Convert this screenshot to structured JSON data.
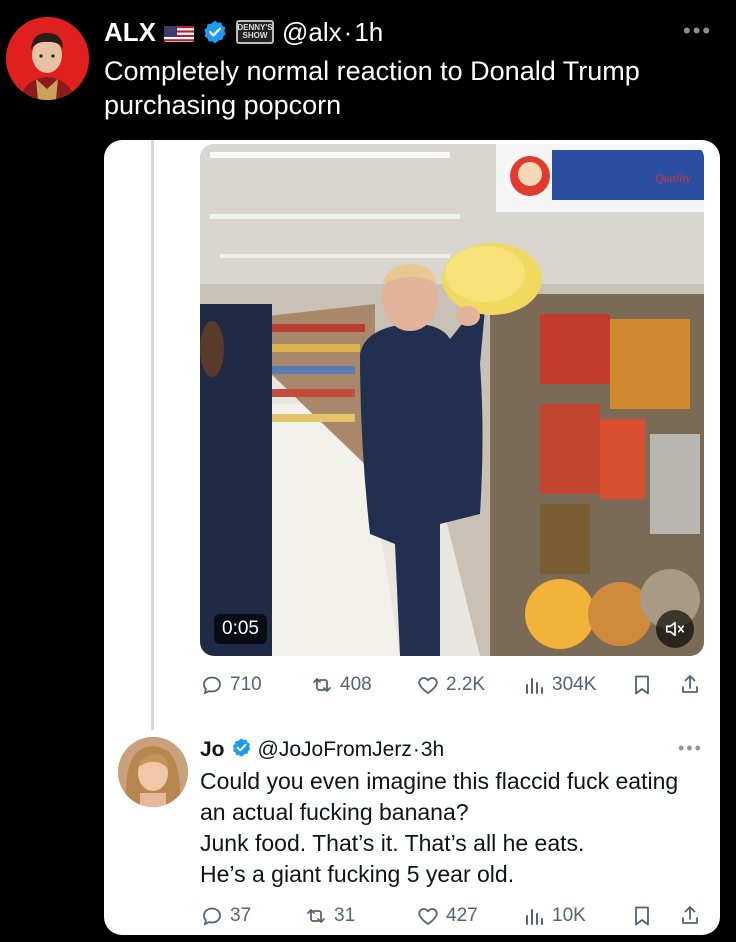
{
  "tweet": {
    "name": "ALX",
    "handle": "@alx",
    "time": "1h",
    "emblem_text": "DENNY'S SHOW",
    "text": "Completely normal reaction to Donald Trump purchasing popcorn",
    "media": {
      "duration": "0:05",
      "sign_text": "Quality"
    },
    "stats": {
      "replies": "710",
      "reposts": "408",
      "likes": "2.2K",
      "views": "304K"
    }
  },
  "reply": {
    "name": "Jo",
    "handle": "@JoJoFromJerz",
    "time": "3h",
    "lines": [
      "Could you even imagine this flaccid fuck eating an actual fucking banana?",
      "Junk food. That’s it. That’s all he eats.",
      "He’s a giant fucking 5 year old."
    ],
    "stats": {
      "replies": "37",
      "reposts": "31",
      "likes": "427",
      "views": "10K"
    }
  },
  "separator": "·",
  "colors": {
    "verified": "#1d9bf0",
    "avatar_bg": "#e01f1f",
    "muted": "#536471"
  }
}
